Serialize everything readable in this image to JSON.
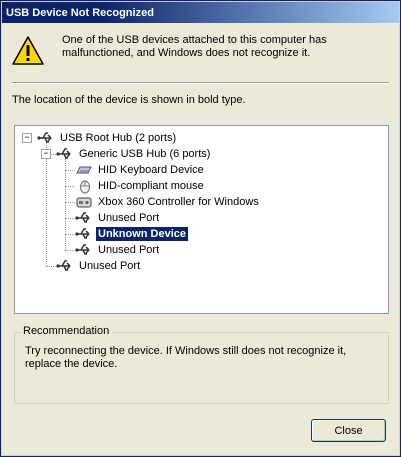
{
  "window": {
    "title": "USB Device Not Recognized"
  },
  "message": "One of the USB devices attached to this computer has malfunctioned, and Windows does not recognize it.",
  "instruction": "The location of the device is shown in bold type.",
  "tree": {
    "nodes": [
      {
        "label": "USB Root Hub (2 ports)",
        "icon": "usb-icon",
        "expander": "minus"
      },
      {
        "label": "Generic USB Hub (6 ports)",
        "icon": "usb-icon",
        "expander": "minus"
      },
      {
        "label": "HID Keyboard Device",
        "icon": "keyboard-icon"
      },
      {
        "label": "HID-compliant mouse",
        "icon": "mouse-icon"
      },
      {
        "label": "Xbox 360 Controller for Windows",
        "icon": "controller-icon"
      },
      {
        "label": "Unused Port",
        "icon": "usb-icon"
      },
      {
        "label": "Unknown Device",
        "icon": "usb-icon",
        "selected": true
      },
      {
        "label": "Unused Port",
        "icon": "usb-icon"
      },
      {
        "label": "Unused Port",
        "icon": "usb-icon"
      }
    ]
  },
  "recommendation": {
    "legend": "Recommendation",
    "text": "Try reconnecting the device. If Windows still does not recognize it, replace the device."
  },
  "buttons": {
    "close": "Close"
  },
  "colors": {
    "title_bar": "#0a246a",
    "selection": "#0a246a",
    "dialog_bg": "#ece9d8"
  }
}
